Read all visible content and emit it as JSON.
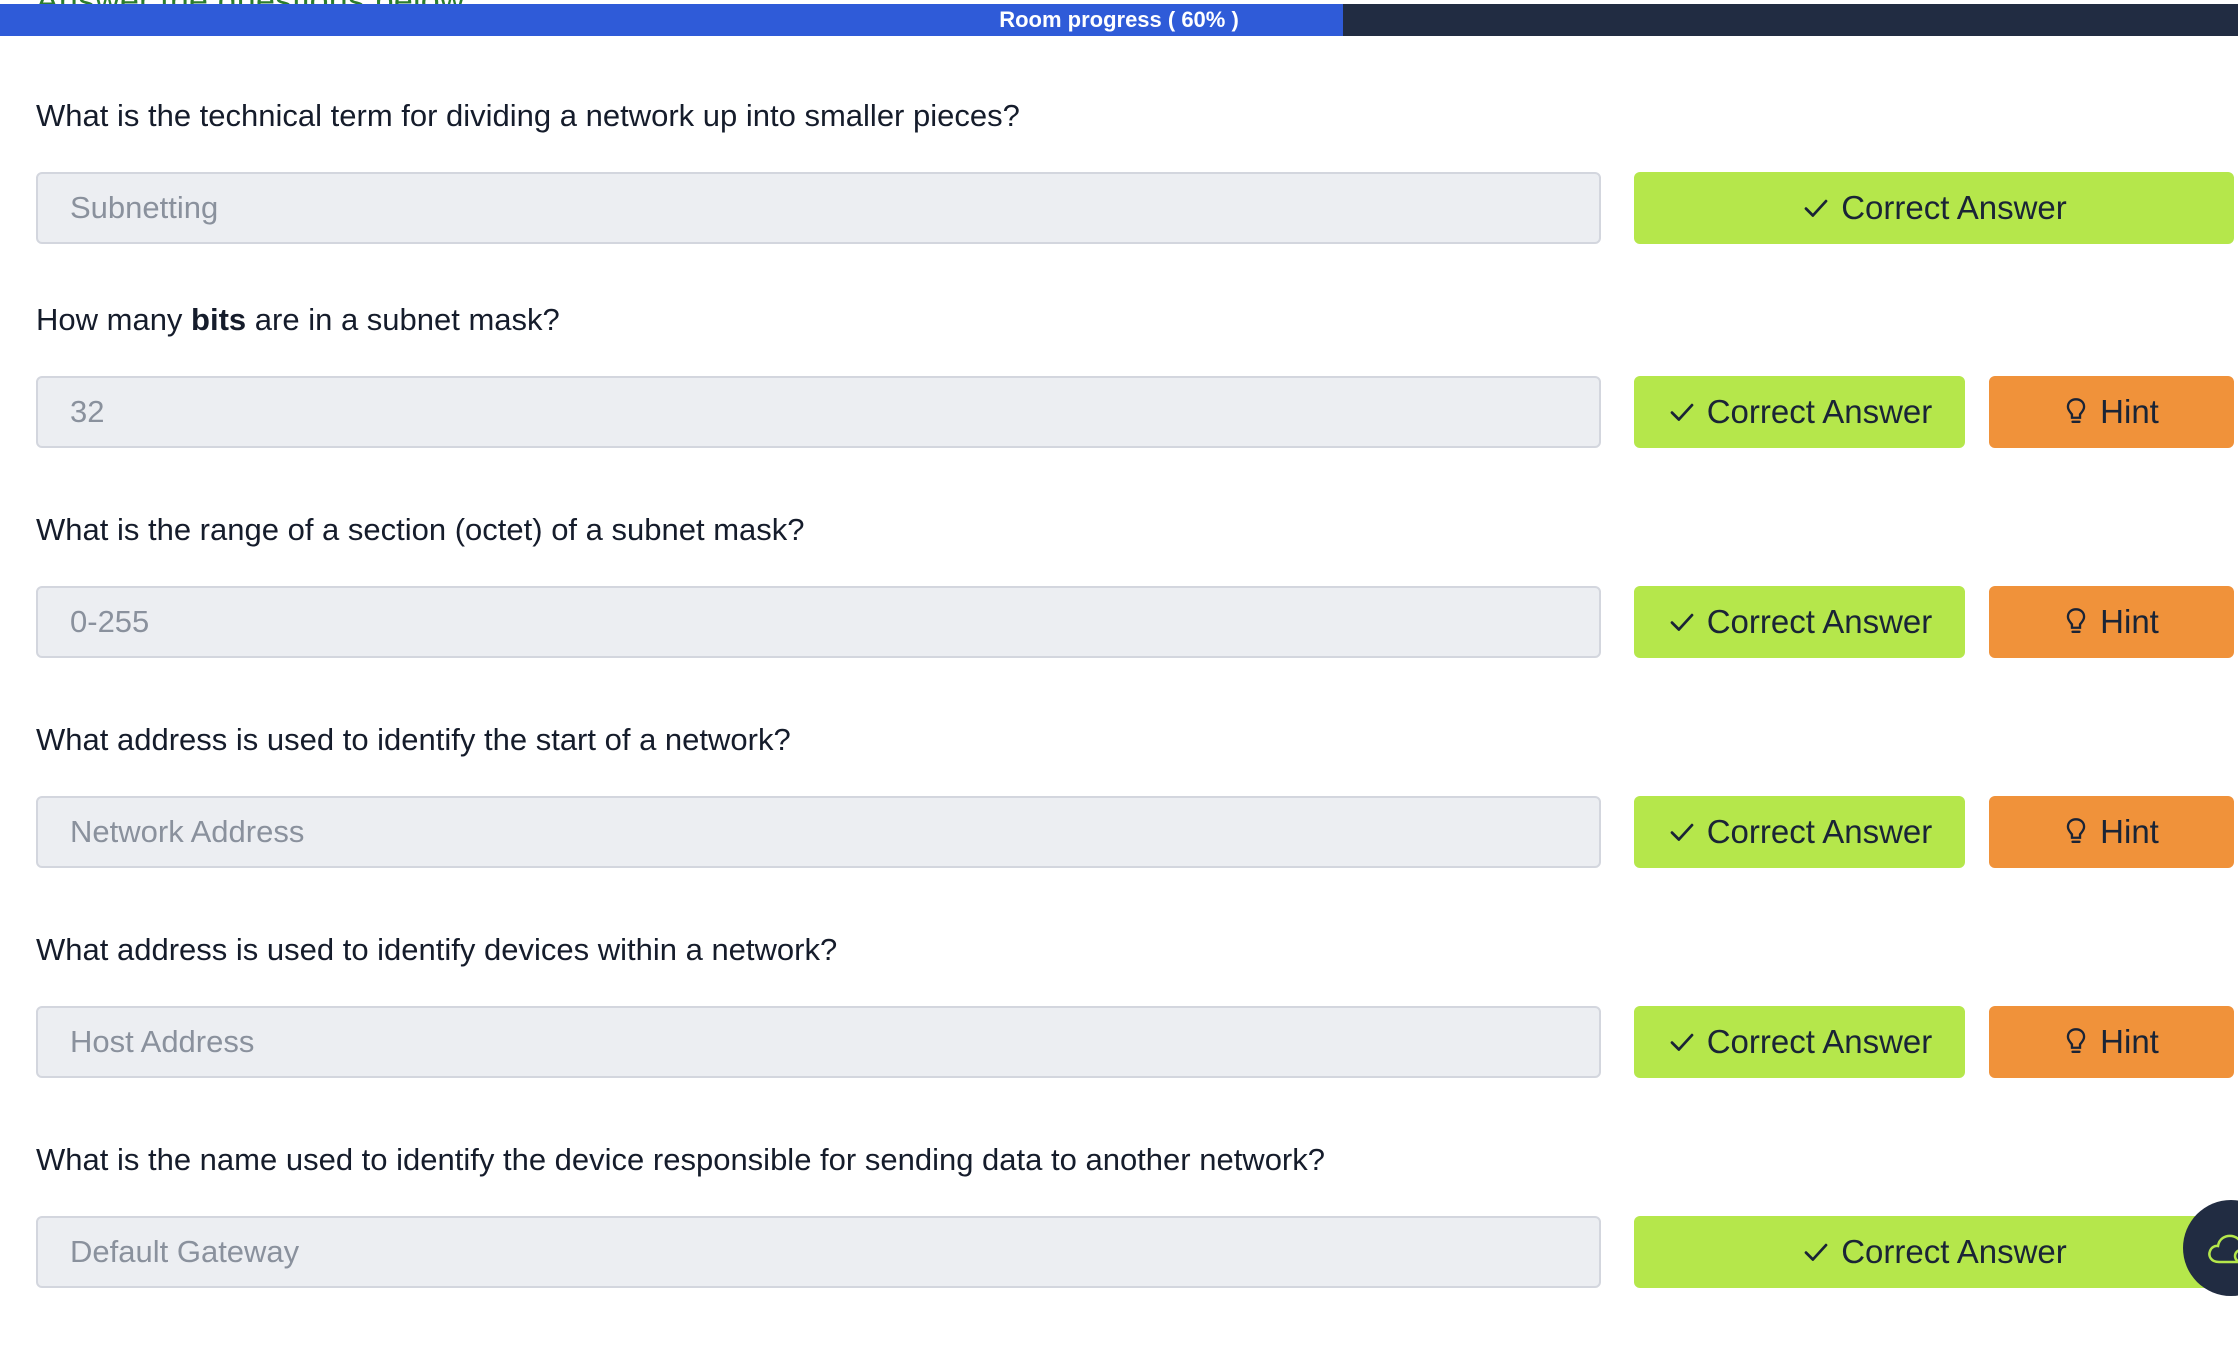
{
  "header": {
    "cut_heading": "Answer the questions below",
    "progress_label": "Room progress ( 60% )",
    "progress_fraction": 0.6
  },
  "tasks": [
    {
      "question": "What is the technical term for dividing a network up into smaller pieces?",
      "answer": "Subnetting",
      "status_label": "Correct Answer",
      "has_hint": false
    },
    {
      "question_pre": "How many ",
      "question_bold": "bits",
      "question_post": " are in a subnet mask?",
      "answer": "32",
      "status_label": "Correct Answer",
      "hint_label": "Hint",
      "has_hint": true
    },
    {
      "question": "What is the range of a section (octet) of a subnet mask?",
      "answer": "0-255",
      "status_label": "Correct Answer",
      "hint_label": "Hint",
      "has_hint": true
    },
    {
      "question": "What address is used to identify the start of a network?",
      "answer": "Network Address",
      "status_label": "Correct Answer",
      "hint_label": "Hint",
      "has_hint": true
    },
    {
      "question": "What address is used to identify devices within a network?",
      "answer": "Host Address",
      "status_label": "Correct Answer",
      "hint_label": "Hint",
      "has_hint": true
    },
    {
      "question": "What is the name used to identify the device responsible for sending data to another network?",
      "answer": "Default Gateway",
      "status_label": "Correct Answer",
      "has_hint": false
    }
  ],
  "icons": {
    "check": "check-icon",
    "hint": "lightbulb-icon",
    "chat": "cloud-chat-icon"
  },
  "colors": {
    "progress_fill": "#2f5bd8",
    "progress_track": "#212c42",
    "correct": "#b5e74b",
    "hint": "#f0923a",
    "input_bg": "#eceef2"
  }
}
